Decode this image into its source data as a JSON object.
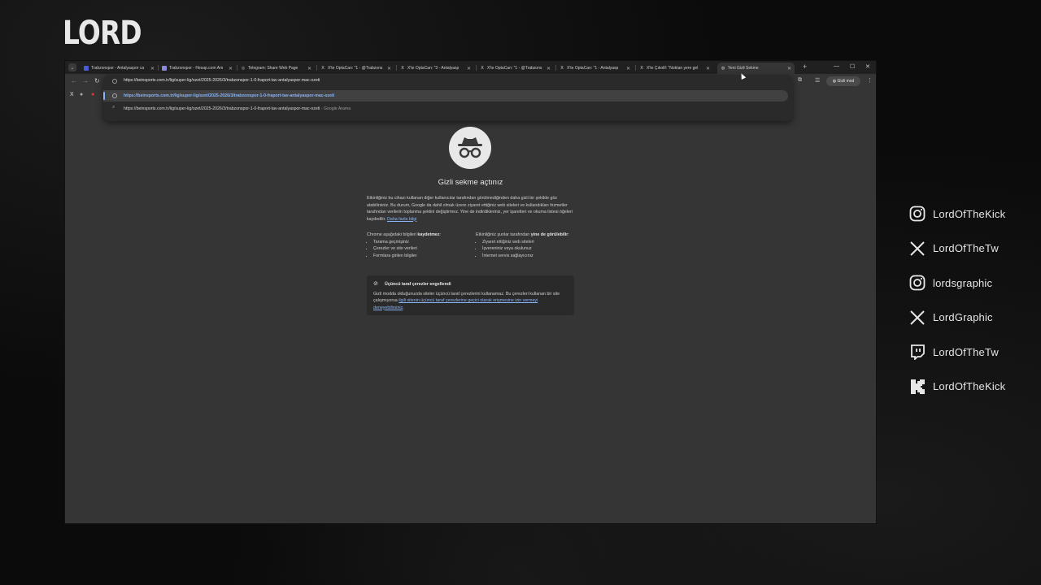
{
  "overlay": {
    "logo": "LORD",
    "socials": [
      {
        "icon": "instagram-icon",
        "handle": "LordOfTheKick"
      },
      {
        "icon": "x-icon",
        "handle": "LordOfTheTw"
      },
      {
        "icon": "instagram-icon",
        "handle": "lordsgraphic"
      },
      {
        "icon": "x-icon",
        "handle": "LordGraphic"
      },
      {
        "icon": "twitch-icon",
        "handle": "LordOfTheTw"
      },
      {
        "icon": "kick-icon",
        "handle": "LordOfTheKick"
      }
    ]
  },
  "browser": {
    "tabs": [
      {
        "title": "Trabzonspor - Antalyaspor ca",
        "icon": "tab-favicon"
      },
      {
        "title": "Trabzonspor - Hesap.com Am",
        "icon": "tab-favicon"
      },
      {
        "title": "Telegram: Share Web Page",
        "icon": "telegram-icon"
      },
      {
        "title": "X'te OptaCan: \"1 - @Trabzons",
        "icon": "x-icon"
      },
      {
        "title": "X'te OptaCan: \"3 - Antalyasp",
        "icon": "x-icon"
      },
      {
        "title": "X'te OptaCan: \"1 - @Trabzons",
        "icon": "x-icon"
      },
      {
        "title": "X'te OptaCan: \"1 - Antalyasp",
        "icon": "x-icon"
      },
      {
        "title": "X'te Çıkolif: \"Noktan yere gel",
        "icon": "x-icon"
      },
      {
        "title": "Yeni Gizli Sekme",
        "icon": "incognito-icon",
        "active": true
      }
    ],
    "address_text": "https://beinsports.com.tr/lig/super-lig/ozet/2025-2026/3/trabzonspor-1-0-fraport-tav-antalyaspor-mac-ozeti",
    "suggestions": [
      {
        "text": "https://beinsports.com.tr/lig/super-lig/ozet/2025-2026/3/trabzonspor-1-0-fraport-tav-antalyaspor-mac-ozeti",
        "suffix": ""
      },
      {
        "text": "https://beinsports.com.tr/lig/super-lig/ozet/2025-2026/3/trabzonspor-1-0-fraport-tav-antalyaspor-mac-ozeti",
        "suffix": " - Google Arama"
      }
    ],
    "incognito_pill": "Gizli mod"
  },
  "ntp": {
    "title": "Gizli sekme açtınız",
    "para": "Etkinliğiniz bu cihazı kullanan diğer kullanıcılar tarafından görülmediğinden daha gizli bir şekilde göz atabilirsiniz. Bu durum, Google da dahil olmak üzere ziyaret ettiğiniz web siteleri ve kullandıkları hizmetler tarafından verilerin toplanma şeklini değiştirmez. Yine de indirdikleriniz, yer işaretleri ve okuma listesi öğeleri kaydedilir.",
    "para_link": "Daha fazla bilgi",
    "left_head_pre": "Chrome aşağıdaki bilgileri ",
    "left_head_bold": "kaydetmez",
    "left_head_post": ":",
    "left_items": [
      "Tarama geçmişiniz",
      "Çerezler ve site verileri",
      "Formlara girilen bilgiler"
    ],
    "right_head_pre": "Etkinliğiniz şunlar tarafından ",
    "right_head_bold": "yine de görülebilir",
    "right_head_post": ":",
    "right_items": [
      "Ziyaret ettiğiniz web siteleri",
      "İşvereniniz veya okulunuz",
      "İnternet servis sağlayıcınız"
    ],
    "cookie_title": "Üçüncü taraf çerezler engellendi",
    "cookie_body": "Gizli modda olduğunuzda siteler üçüncü taraf çerezlerini kullanamaz. Bu çerezleri kullanan bir site çalışmıyorsa ",
    "cookie_link": "ilgili sitenin üçüncü taraf çerezlerine geçici olarak erişmesine izin vermeyi deneyebilirsiniz",
    "cookie_end": "."
  }
}
